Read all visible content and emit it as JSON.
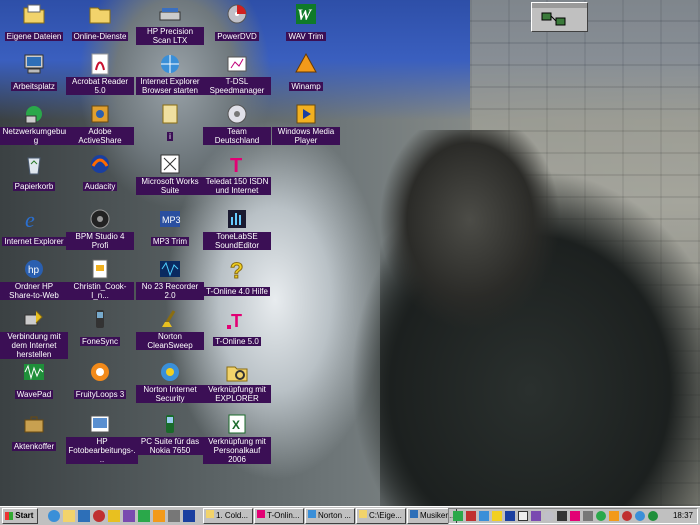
{
  "desktop": {
    "icons": [
      {
        "label": "Eigene Dateien",
        "icon": "folder-icon"
      },
      {
        "label": "Online-Dienste",
        "icon": "folder-icon"
      },
      {
        "label": "HP Precision Scan LTX",
        "icon": "scanner-icon"
      },
      {
        "label": "PowerDVD",
        "icon": "dvd-icon"
      },
      {
        "label": "WAV Trim",
        "icon": "wav-trim-icon"
      },
      {
        "label": "Arbeitsplatz",
        "icon": "computer-icon"
      },
      {
        "label": "Acrobat Reader 5.0",
        "icon": "acrobat-icon"
      },
      {
        "label": "Internet Explorer Browser starten",
        "icon": "ie-globe-icon"
      },
      {
        "label": "T-DSL Speedmanager",
        "icon": "speedmanager-icon"
      },
      {
        "label": "Winamp",
        "icon": "winamp-icon"
      },
      {
        "label": "Netzwerkumgebung",
        "icon": "network-icon"
      },
      {
        "label": "Adobe ActiveShare",
        "icon": "activeshare-icon"
      },
      {
        "label": "i",
        "icon": "document-icon"
      },
      {
        "label": "Team Deutschland",
        "icon": "cd-icon"
      },
      {
        "label": "Windows Media Player",
        "icon": "media-player-icon"
      },
      {
        "label": "Papierkorb",
        "icon": "recycle-bin-icon"
      },
      {
        "label": "Audacity",
        "icon": "audacity-icon"
      },
      {
        "label": "Microsoft Works Suite",
        "icon": "works-icon"
      },
      {
        "label": "Teledat 150 ISDN und Internet",
        "icon": "telekom-icon"
      },
      {
        "label": "Internet Explorer",
        "icon": "ie-icon"
      },
      {
        "label": "BPM Studio 4 Profi",
        "icon": "bpm-studio-icon"
      },
      {
        "label": "MP3 Trim",
        "icon": "mp3-trim-icon"
      },
      {
        "label": "ToneLabSE SoundEditor",
        "icon": "tonelab-icon"
      },
      {
        "label": "Ordner HP Share-to-Web",
        "icon": "hp-share-icon"
      },
      {
        "label": "Christin_Cook-I_n...",
        "icon": "file-icon"
      },
      {
        "label": "No 23 Recorder 2.0",
        "icon": "recorder-icon"
      },
      {
        "label": "T-Online 4.0 Hilfe",
        "icon": "help-icon"
      },
      {
        "label": "Verbindung mit dem Internet herstellen",
        "icon": "connect-icon"
      },
      {
        "label": "FoneSync",
        "icon": "fonesync-icon"
      },
      {
        "label": "Norton CleanSweep",
        "icon": "cleansweep-icon"
      },
      {
        "label": "T-Online 5.0",
        "icon": "t-online-icon"
      },
      {
        "label": "WavePad",
        "icon": "wavepad-icon"
      },
      {
        "label": "FruityLoops 3",
        "icon": "fruityloops-icon"
      },
      {
        "label": "Norton Internet Security",
        "icon": "norton-icon"
      },
      {
        "label": "Verknüpfung mit EXPLORER",
        "icon": "explorer-icon"
      },
      {
        "label": "Aktenkoffer",
        "icon": "briefcase-icon"
      },
      {
        "label": "HP Fotobearbeitungs-...",
        "icon": "hp-photo-icon"
      },
      {
        "label": "PC Suite für das Nokia 7650",
        "icon": "nokia-icon"
      },
      {
        "label": "Verknüpfung mit Personalkauf 2006",
        "icon": "excel-icon"
      }
    ]
  },
  "taskbar": {
    "start_label": "Start",
    "buttons": [
      {
        "label": "1. Cold..."
      },
      {
        "label": "T-Onlin..."
      },
      {
        "label": "Norton ..."
      },
      {
        "label": "C:\\Eige..."
      },
      {
        "label": "Musiker..."
      }
    ],
    "clock": "18:37"
  }
}
